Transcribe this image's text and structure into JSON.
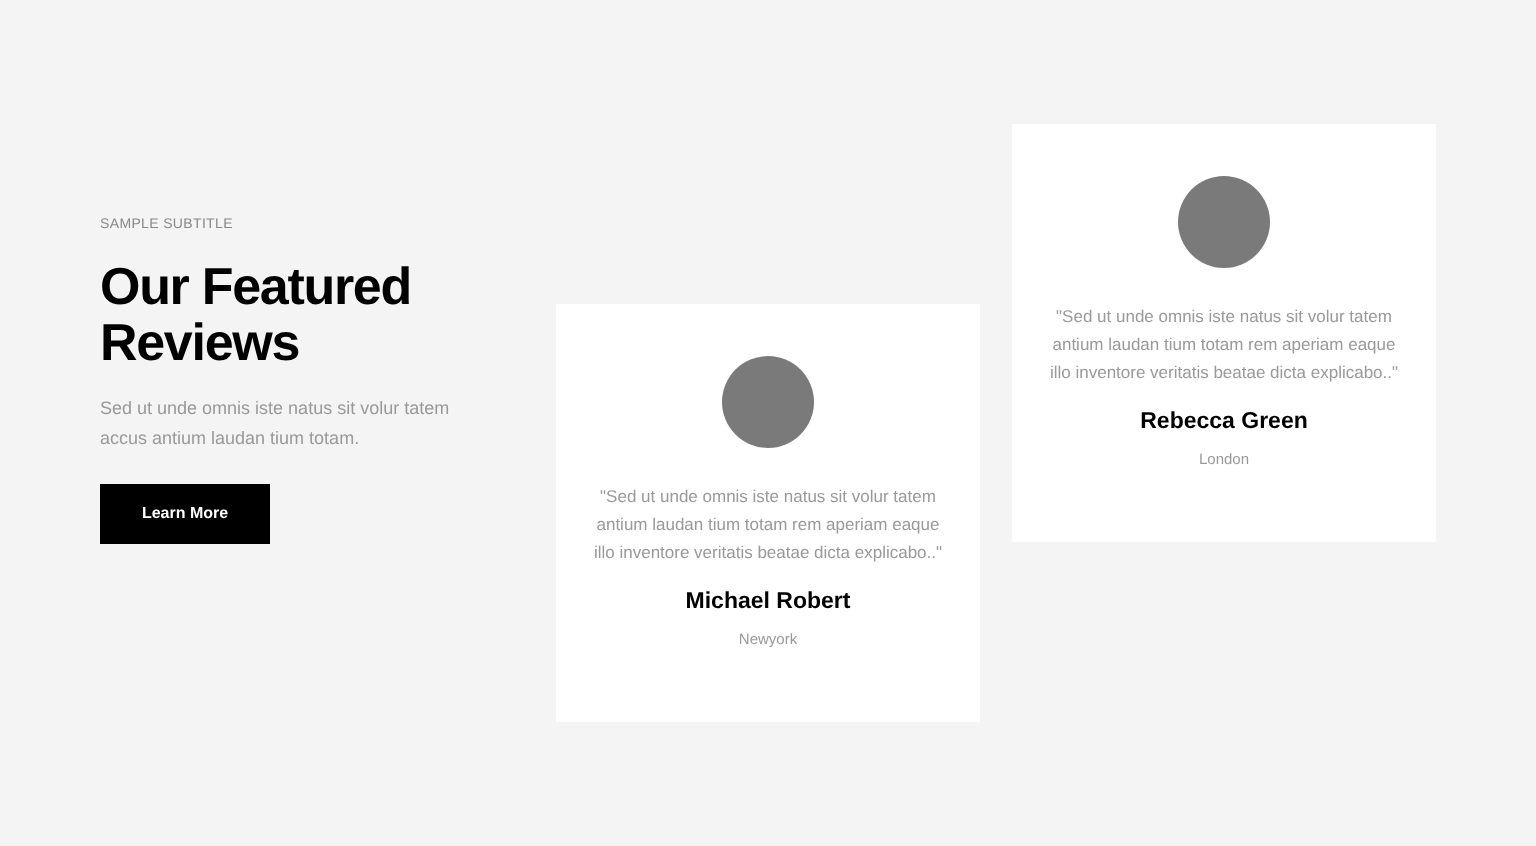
{
  "intro": {
    "subtitle": "SAMPLE SUBTITLE",
    "title": "Our Featured Reviews",
    "description": "Sed ut unde omnis iste natus sit volur tatem accus antium laudan tium totam.",
    "button": "Learn More"
  },
  "reviews": [
    {
      "quote": "\"Sed ut unde omnis iste natus sit volur tatem antium laudan tium totam rem aperiam eaque illo inventore veritatis beatae dicta explicabo..\"",
      "name": "Michael Robert",
      "location": "Newyork"
    },
    {
      "quote": "\"Sed ut unde omnis iste natus sit volur tatem antium laudan tium totam rem aperiam eaque illo inventore veritatis beatae dicta explicabo..\"",
      "name": "Rebecca Green",
      "location": "London"
    }
  ]
}
